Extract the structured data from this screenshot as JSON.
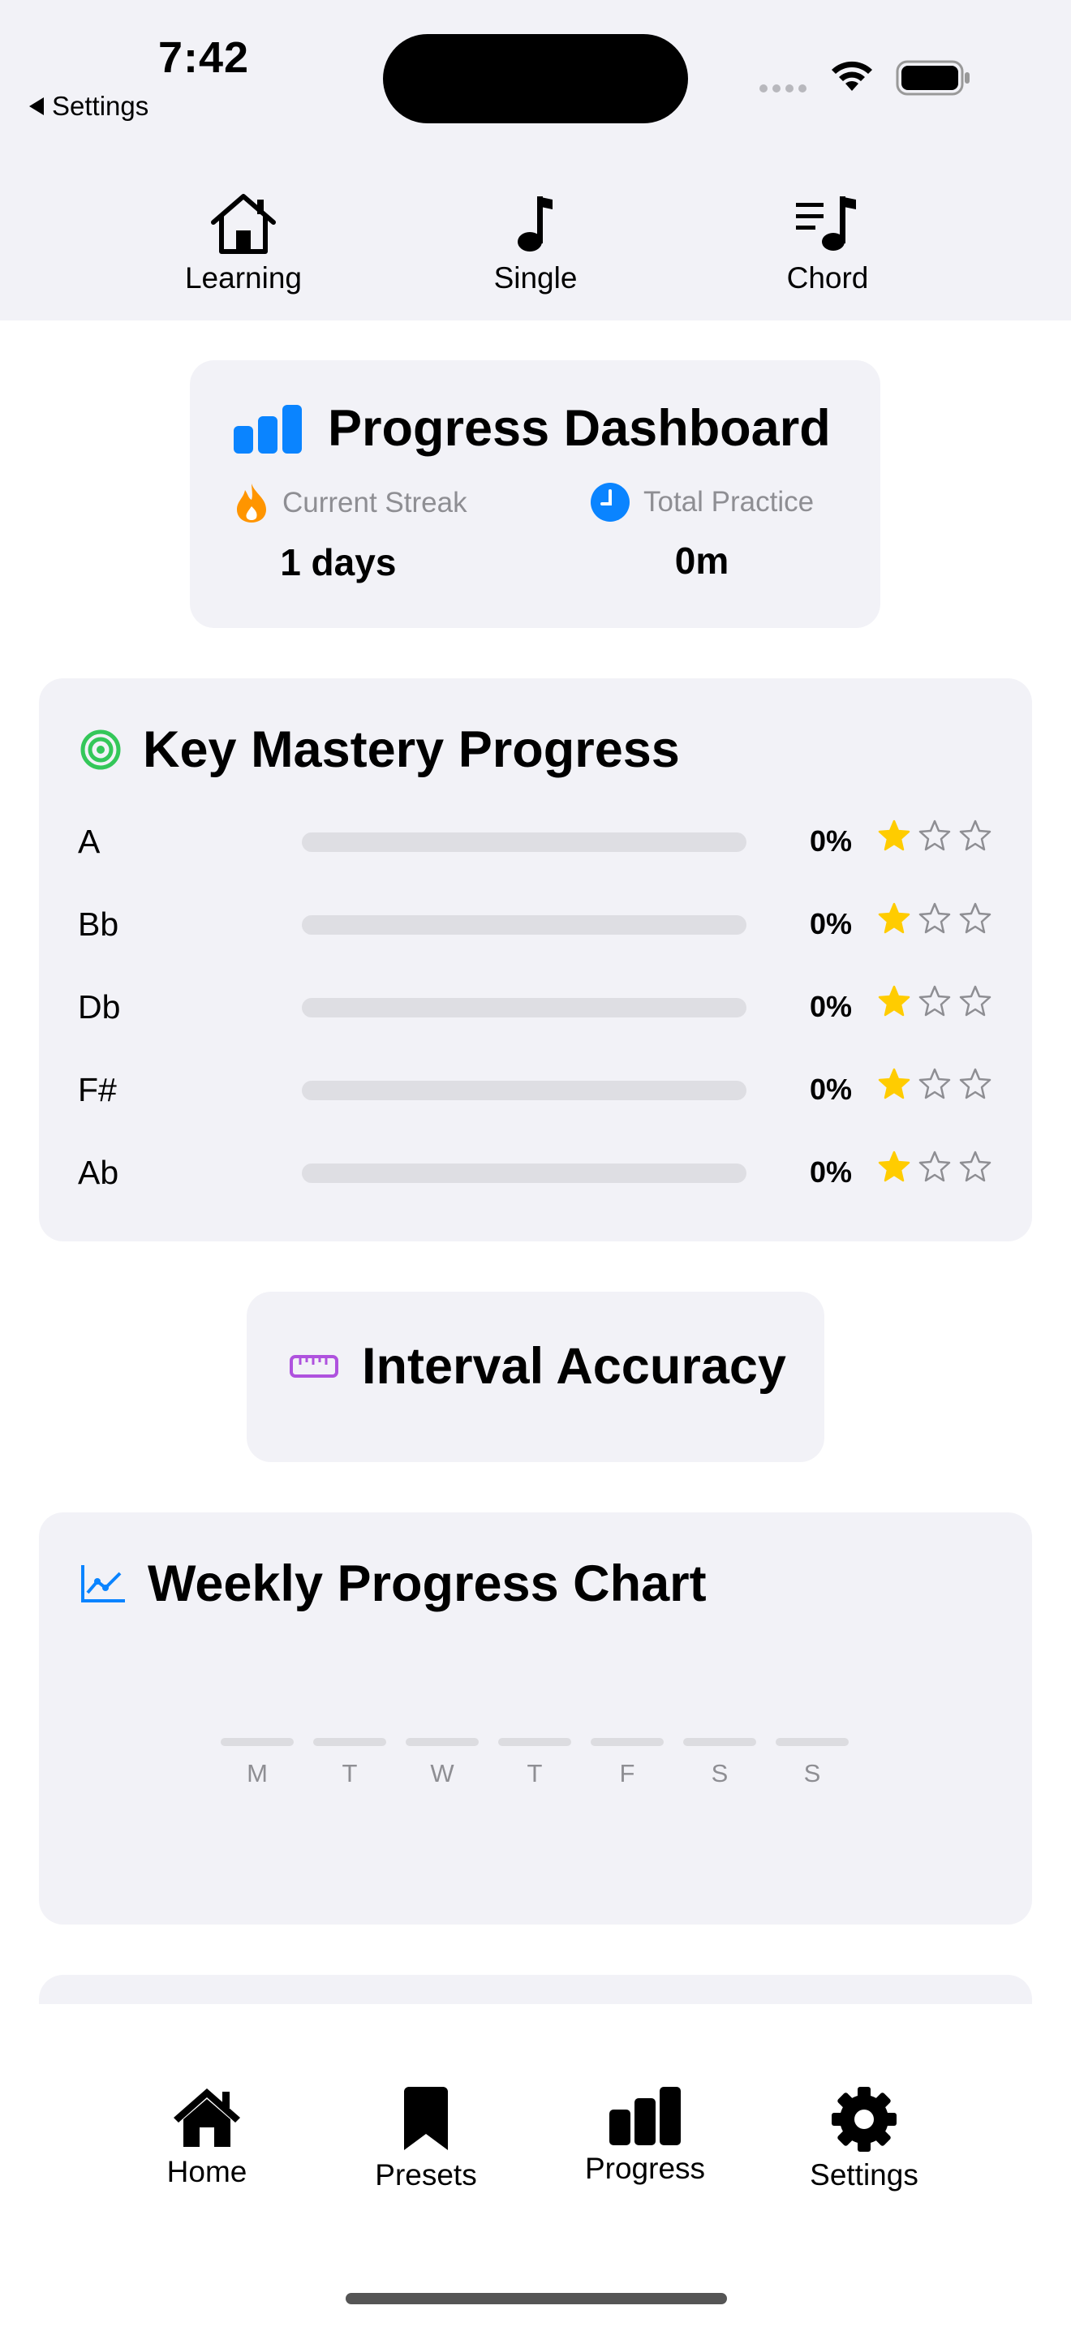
{
  "status_bar": {
    "time": "7:42",
    "back_label": "Settings"
  },
  "top_nav": [
    {
      "label": "Learning",
      "icon": "house-icon"
    },
    {
      "label": "Single",
      "icon": "music-note-icon"
    },
    {
      "label": "Chord",
      "icon": "note-list-icon"
    }
  ],
  "dashboard": {
    "title": "Progress Dashboard",
    "streak_label": "Current Streak",
    "streak_value": "1 days",
    "practice_label": "Total Practice",
    "practice_value": "0m"
  },
  "mastery": {
    "title": "Key Mastery Progress",
    "keys": [
      {
        "name": "A",
        "percent": "0%",
        "progress": 0,
        "stars": 1,
        "max_stars": 3
      },
      {
        "name": "Bb",
        "percent": "0%",
        "progress": 0,
        "stars": 1,
        "max_stars": 3
      },
      {
        "name": "Db",
        "percent": "0%",
        "progress": 0,
        "stars": 1,
        "max_stars": 3
      },
      {
        "name": "F#",
        "percent": "0%",
        "progress": 0,
        "stars": 1,
        "max_stars": 3
      },
      {
        "name": "Ab",
        "percent": "0%",
        "progress": 0,
        "stars": 1,
        "max_stars": 3
      }
    ]
  },
  "interval": {
    "title": "Interval Accuracy"
  },
  "weekly": {
    "title": "Weekly Progress Chart",
    "days": [
      "M",
      "T",
      "W",
      "T",
      "F",
      "S",
      "S"
    ],
    "values": [
      0,
      0,
      0,
      0,
      0,
      0,
      0
    ]
  },
  "tabs": [
    {
      "label": "Home",
      "icon": "house-fill-icon"
    },
    {
      "label": "Presets",
      "icon": "bookmark-icon"
    },
    {
      "label": "Progress",
      "icon": "bar-chart-icon",
      "selected": true
    },
    {
      "label": "Settings",
      "icon": "gear-icon"
    }
  ],
  "colors": {
    "accent_blue": "#0a84ff",
    "streak_orange": "#ff9500",
    "mastery_green": "#34c759",
    "interval_purple": "#af52de",
    "star_yellow": "#ffcc00"
  }
}
